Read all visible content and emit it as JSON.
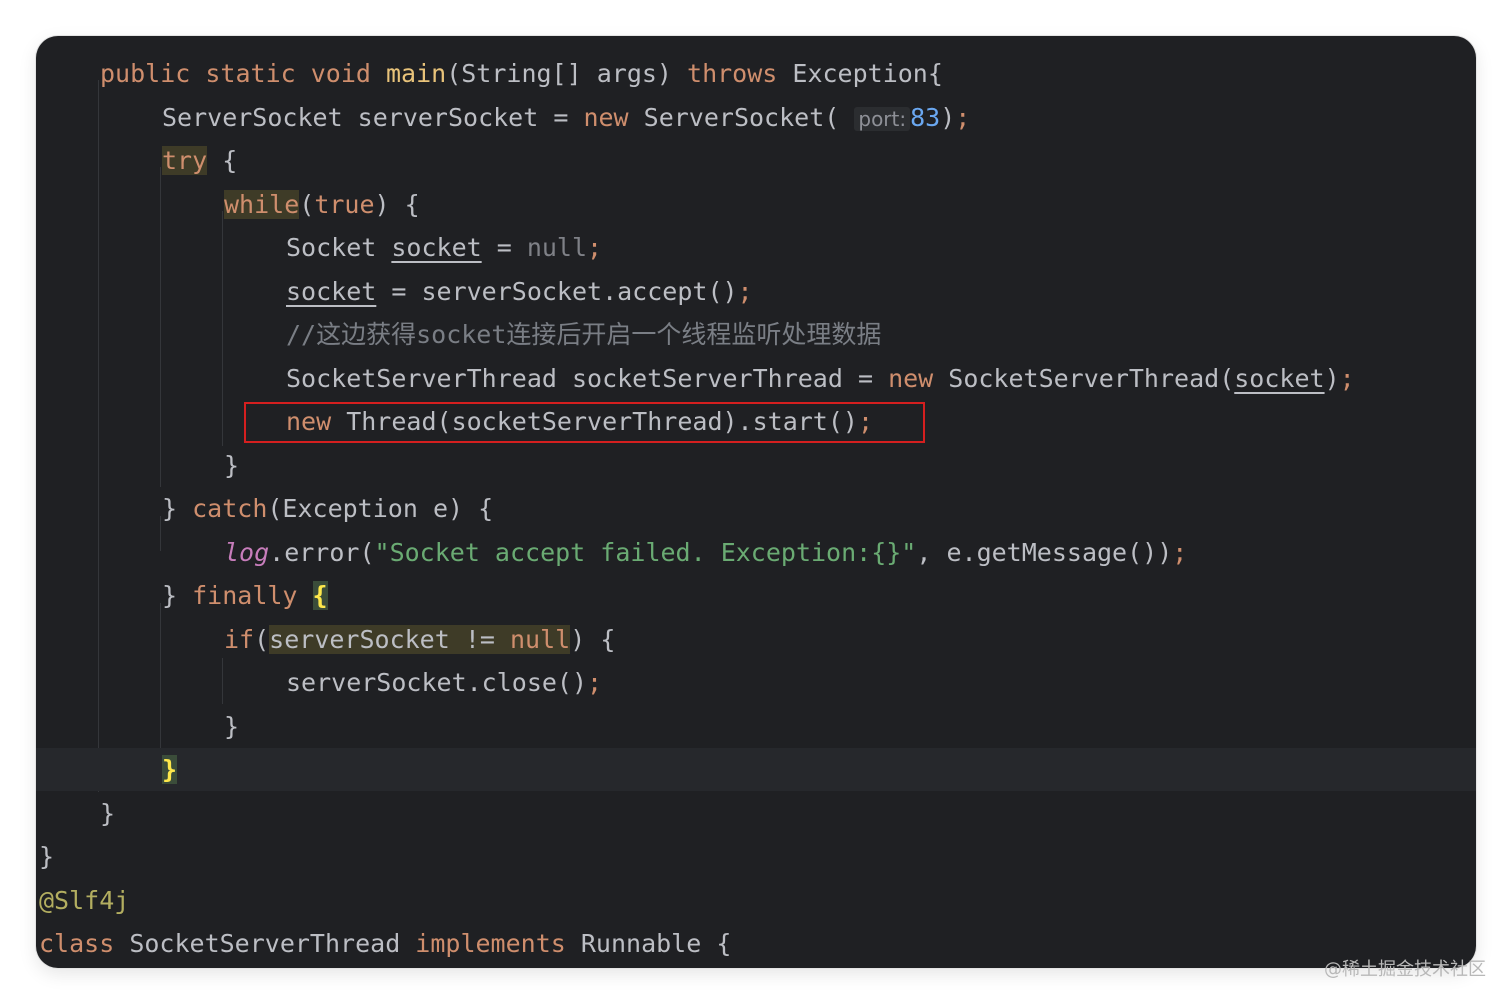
{
  "code": {
    "l1": {
      "kw": "public static void ",
      "method": "main",
      "rest": "(String[] args) ",
      "throws": "throws",
      "tail": " Exception{"
    },
    "l2": {
      "a": "ServerSocket serverSocket = ",
      "new": "new",
      "b": " ServerSocket( ",
      "hint": "port:",
      "num": "83",
      "close": ")",
      "semi": ";"
    },
    "l3": {
      "try": "try",
      "rest": " {"
    },
    "l4": {
      "while": "while",
      "rest": "(",
      "true": "true",
      "tail": ") {"
    },
    "l5": {
      "a": "Socket ",
      "var": "socket",
      "b": " = ",
      "null": "null",
      "semi": ";"
    },
    "l6": {
      "var": "socket",
      "b": " = serverSocket.accept()",
      "semi": ";"
    },
    "l7": {
      "comment": "//这边获得socket连接后开启一个线程监听处理数据"
    },
    "l8": {
      "a": "SocketServerThread socketServerThread = ",
      "new": "new",
      "b": " SocketServerThread(",
      "var": "socket",
      "c": ")",
      "semi": ";"
    },
    "l9": {
      "new": "new",
      "b": " Thread(socketServerThread).start()",
      "semi": ";"
    },
    "l10": {
      "brace": "}"
    },
    "l11": {
      "a": "} ",
      "catch": "catch",
      "b": "(Exception e) {"
    },
    "l12": {
      "log": "log",
      "a": ".error(",
      "str": "\"Socket accept failed. Exception:{}\"",
      "b": ", e.getMessage())",
      "semi": ";"
    },
    "l13": {
      "a": "} ",
      "finally": "finally",
      "b": " ",
      "brace": "{"
    },
    "l14": {
      "if": "if",
      "a": "(",
      "cond": "serverSocket != ",
      "null": "null",
      "b": ") {"
    },
    "l15": {
      "a": "serverSocket.close()",
      "semi": ";"
    },
    "l16": {
      "brace": "}"
    },
    "l17": {
      "brace": "}"
    },
    "l18": {
      "brace": "}"
    },
    "l19": {
      "brace": "}"
    },
    "l20": {
      "annotation": "@Slf4j"
    },
    "l21": {
      "class": "class",
      "a": " SocketServerThread ",
      "implements": "implements",
      "b": " Runnable {"
    }
  },
  "watermark": "@稀土掘金技术社区",
  "colors": {
    "background": "#1f2023",
    "keyword": "#cf8e6d",
    "string": "#6aab73",
    "number": "#6aa7f0",
    "highlight_box": "#d51f1f"
  }
}
